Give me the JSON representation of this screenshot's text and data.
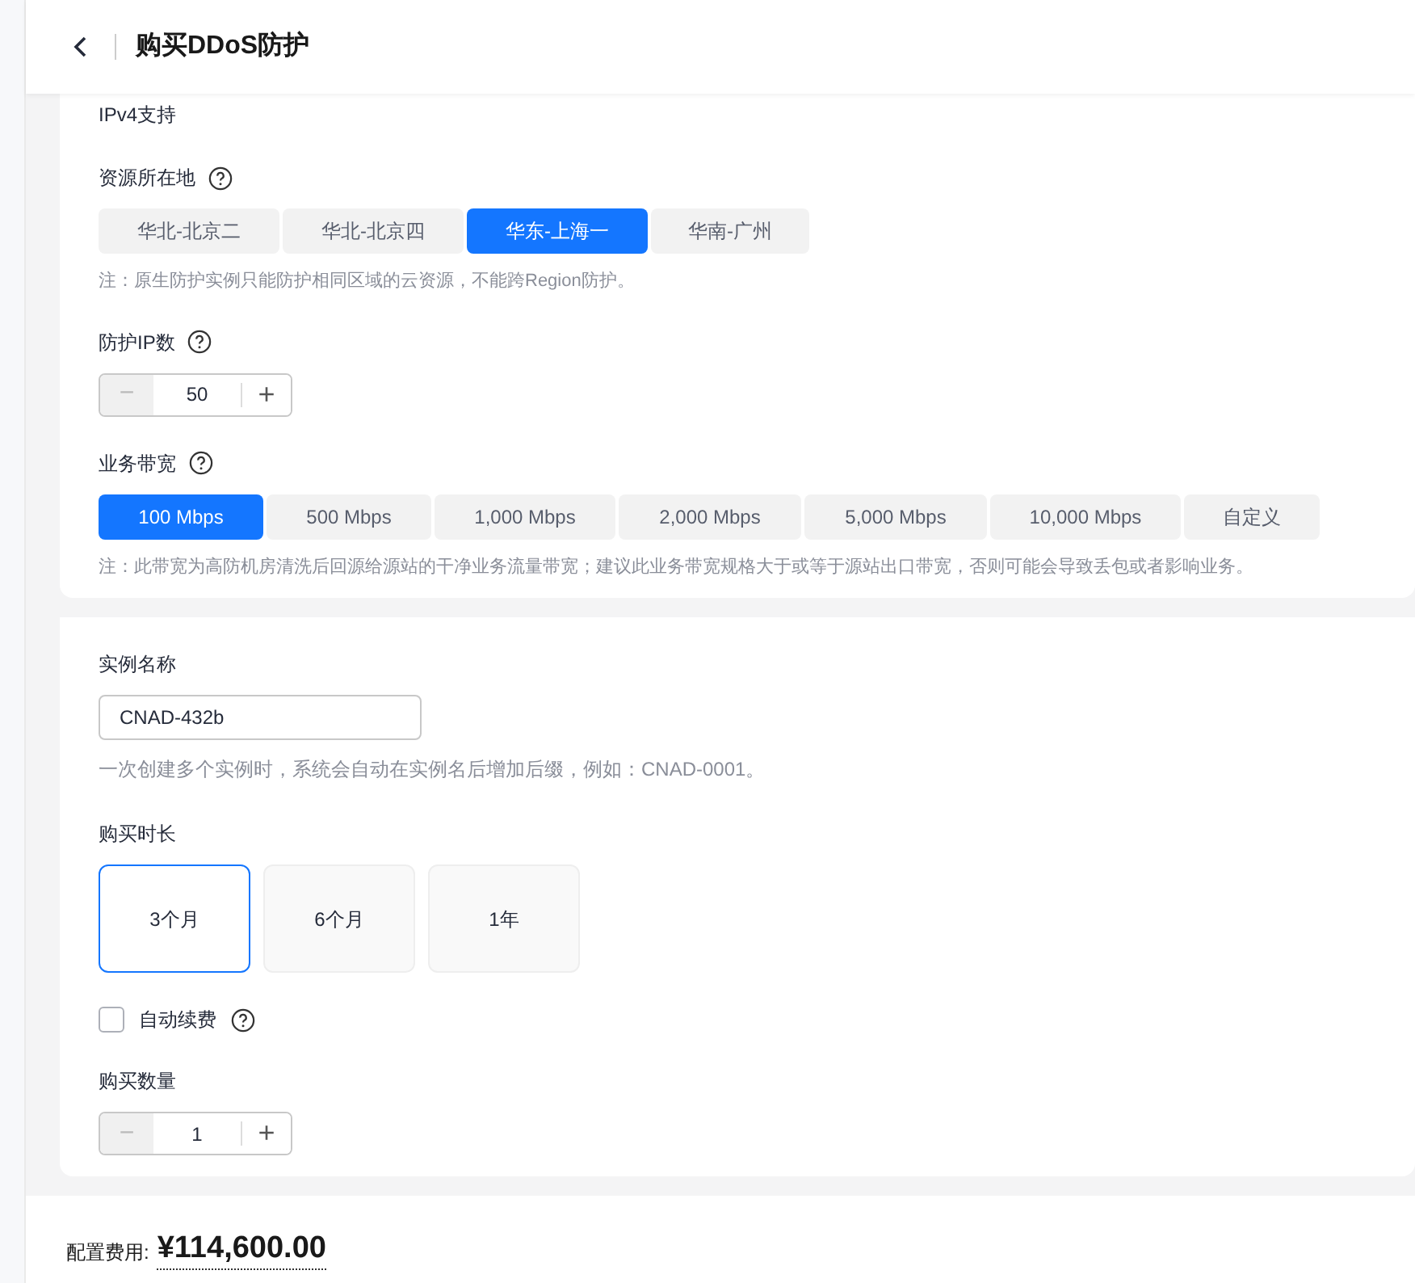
{
  "header": {
    "title": "购买DDoS防护"
  },
  "ip_version": {
    "label": "IPv4支持"
  },
  "region": {
    "label": "资源所在地",
    "options": [
      {
        "label": "华北-北京二",
        "selected": false
      },
      {
        "label": "华北-北京四",
        "selected": false
      },
      {
        "label": "华东-上海一",
        "selected": true
      },
      {
        "label": "华南-广州",
        "selected": false
      }
    ],
    "note": "注：原生防护实例只能防护相同区域的云资源，不能跨Region防护。"
  },
  "ip_count": {
    "label": "防护IP数",
    "value": "50",
    "decrement": "−",
    "increment": "+"
  },
  "bandwidth": {
    "label": "业务带宽",
    "options": [
      {
        "label": "100 Mbps",
        "selected": true
      },
      {
        "label": "500 Mbps",
        "selected": false
      },
      {
        "label": "1,000 Mbps",
        "selected": false
      },
      {
        "label": "2,000 Mbps",
        "selected": false
      },
      {
        "label": "5,000 Mbps",
        "selected": false
      },
      {
        "label": "10,000 Mbps",
        "selected": false
      },
      {
        "label": "自定义",
        "selected": false
      }
    ],
    "note": "注：此带宽为高防机房清洗后回源给源站的干净业务流量带宽；建议此业务带宽规格大于或等于源站出口带宽，否则可能会导致丢包或者影响业务。"
  },
  "instance_name": {
    "label": "实例名称",
    "value": "CNAD-432b",
    "hint": "一次创建多个实例时，系统会自动在实例名后增加后缀，例如：CNAD-0001。"
  },
  "duration": {
    "label": "购买时长",
    "options": [
      {
        "label": "3个月",
        "selected": true
      },
      {
        "label": "6个月",
        "selected": false
      },
      {
        "label": "1年",
        "selected": false
      }
    ]
  },
  "auto_renew": {
    "label": "自动续费",
    "checked": false
  },
  "quantity": {
    "label": "购买数量",
    "value": "1",
    "decrement": "−",
    "increment": "+"
  },
  "footer": {
    "label": "配置费用:",
    "price": "¥114,600.00"
  }
}
